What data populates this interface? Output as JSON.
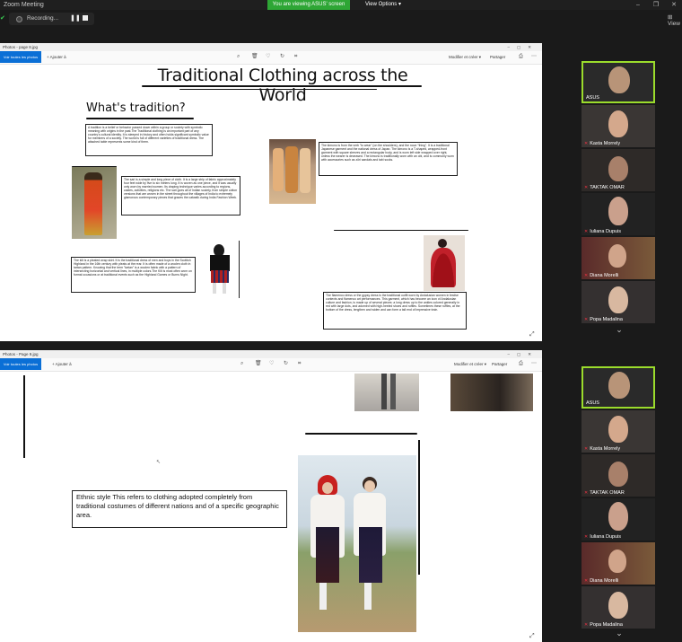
{
  "window": {
    "title": "Zoom Meeting",
    "viewing_banner": "You are viewing ASUS' screen",
    "view_options": "View Options",
    "view_label": "View"
  },
  "recording": {
    "label": "Recording..."
  },
  "photo_app_top": {
    "title": "Photos - page 8.jpg",
    "see_all": "Voir toutes les photos",
    "add": "Ajouter à",
    "edit": "Modifier et créer",
    "share": "Partager"
  },
  "photo_app_bottom": {
    "title": "Photos - Page 9.jpg",
    "see_all": "Voir toutes les photos",
    "add": "Ajouter à",
    "edit": "Modifier et créer",
    "share": "Partager"
  },
  "slide_top": {
    "title": "Traditional Clothing across the World",
    "subtitle": "What's tradition?",
    "para_tradition": "A tradition is a belief or behavior passed down within a group or society with symbolic meaning with origins in the past.The Traditional clothing is an important part of any country's cultural identity. It is steeped in history and often holds significant symbolic value for members of a society. The world is full of different varieties of traditional dress. The attached table represents some kind of them.",
    "para_kimono": "The kimono is from the verb \"to wear\" (on the shoulders), and the noun \"thing\". It is a traditional Japanese garment and the national dress of Japan. The kimono is a T-shaped, wrapped-front garment with square sleeves and a rectangular body, and is worn left side wrapped over right, unless the wearer is deceased. The kimono is traditionally worn with an obi, and is commonly worn with accessories such as zōri sandals and tabi socks.",
    "para_sari": "The sari is a simple and long piece of cloth. It is a large strip of fabric approximately four feet wide by five to six meters long. It is woven as one piece, and it was usually only worn by married women. Its draping technique varies according to regions, castes, activities, religions etc. The sari goes all of Indian society, from simple cotton versions that are woven in the street throughout the villages of India to extremely glamorous contemporary pieces that graces the catwalk during India Fashion Week.",
    "para_kilt": "The kilt is a pleated wrap skirt. It is the traditional dress of men and boys in the Scottish Highland in the 16th century with pleats at the rear. It is often made of a woolen cloth in tartan pattern. Knowing that the term \"tartan\" is a woolen fabric with a pattern of intersecting horizontal and vertical lines, in multiple colors.The Kilt is most often worn on formal occasions or at traditional events such as the Highland Games or Burns Night.",
    "para_flamenco": "The flamenco dress or the gypsy dress is the traditional outfit worn by Andalusian women in festive contexts and flamenco art performances. This garment, which has become an icon of Andalusian culture and fashion, is made up of several pieces: a long dress up to the ankles colored generally in red with large dots, and adorned with high-heeled shoes and ruffles. Sometimes these ruffles, at the bottom of the dress, lengthen and widen and can form a tail end of impressive train."
  },
  "slide_bottom": {
    "ethnic_title": "Ethnic  style",
    "ethnic_text": "This refers to clothing adopted completely from traditional costumes of different nations and of a specific geographic area."
  },
  "participants": [
    {
      "name": "ASUS",
      "active": true
    },
    {
      "name": "Kasta Morrely",
      "active": false
    },
    {
      "name": "TAKTAK OMAR",
      "active": false
    },
    {
      "name": "Iuliana Dupuis",
      "active": false
    },
    {
      "name": "Diana Morelli",
      "active": false
    },
    {
      "name": "Popa Madalina",
      "active": false
    }
  ],
  "colors": {
    "accent_green": "#2ea635",
    "active_border": "#9bdc2c",
    "photos_blue": "#0a6fd6"
  }
}
